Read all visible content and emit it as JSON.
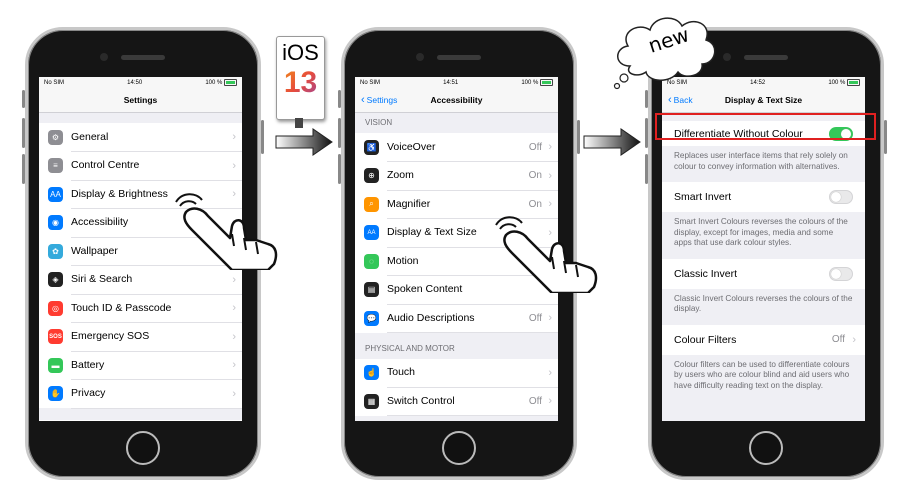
{
  "badge": {
    "line1": "iOS",
    "line2": "13"
  },
  "cloud": {
    "text": "new"
  },
  "status": {
    "carrier": "No SIM",
    "battery": "100 %",
    "time1": "14:50",
    "time2": "14:51",
    "time3": "14:52"
  },
  "phone1": {
    "title": "Settings",
    "items": [
      {
        "label": "General",
        "icon": "gear-icon",
        "color": "#8e8e93"
      },
      {
        "label": "Control Centre",
        "icon": "switches-icon",
        "color": "#8e8e93"
      },
      {
        "label": "Display & Brightness",
        "icon": "AA",
        "color": "#007aff"
      },
      {
        "label": "Accessibility",
        "icon": "accessibility-icon",
        "color": "#007aff"
      },
      {
        "label": "Wallpaper",
        "icon": "flower-icon",
        "color": "#34aadc"
      },
      {
        "label": "Siri & Search",
        "icon": "siri-icon",
        "color": "#222222"
      },
      {
        "label": "Touch ID & Passcode",
        "icon": "fingerprint-icon",
        "color": "#ff3b30"
      },
      {
        "label": "Emergency SOS",
        "icon": "SOS",
        "color": "#ff3b30"
      },
      {
        "label": "Battery",
        "icon": "battery-icon",
        "color": "#34c759"
      },
      {
        "label": "Privacy",
        "icon": "hand-icon",
        "color": "#007aff"
      }
    ]
  },
  "phone2": {
    "back": "Settings",
    "title": "Accessibility",
    "section_vision": "VISION",
    "vision_items": [
      {
        "label": "VoiceOver",
        "value": "Off",
        "color": "#222222"
      },
      {
        "label": "Zoom",
        "value": "On",
        "color": "#222222"
      },
      {
        "label": "Magnifier",
        "value": "On",
        "color": "#ff9500"
      },
      {
        "label": "Display & Text Size",
        "value": "",
        "color": "#007aff"
      },
      {
        "label": "Motion",
        "value": "",
        "color": "#34c759"
      },
      {
        "label": "Spoken Content",
        "value": "",
        "color": "#222222"
      },
      {
        "label": "Audio Descriptions",
        "value": "Off",
        "color": "#007aff"
      }
    ],
    "section_motor": "PHYSICAL AND MOTOR",
    "motor_items": [
      {
        "label": "Touch",
        "value": "",
        "color": "#007aff"
      },
      {
        "label": "Switch Control",
        "value": "Off",
        "color": "#222222"
      }
    ]
  },
  "phone3": {
    "back": "Back",
    "title": "Display & Text Size",
    "diff_label": "Differentiate Without Colour",
    "diff_desc": "Replaces user interface items that rely solely on colour to convey information with alternatives.",
    "smart_label": "Smart Invert",
    "smart_desc": "Smart Invert Colours reverses the colours of the display, except for images, media and some apps that use dark colour styles.",
    "classic_label": "Classic Invert",
    "classic_desc": "Classic Invert Colours reverses the colours of the display.",
    "filters_label": "Colour Filters",
    "filters_value": "Off",
    "filters_desc": "Colour filters can be used to differentiate colours by users who are colour blind and aid users who have difficulty reading text on the display."
  },
  "colors": {
    "highlight": "#e02020",
    "toggle_on": "#34c759",
    "link": "#007aff"
  }
}
